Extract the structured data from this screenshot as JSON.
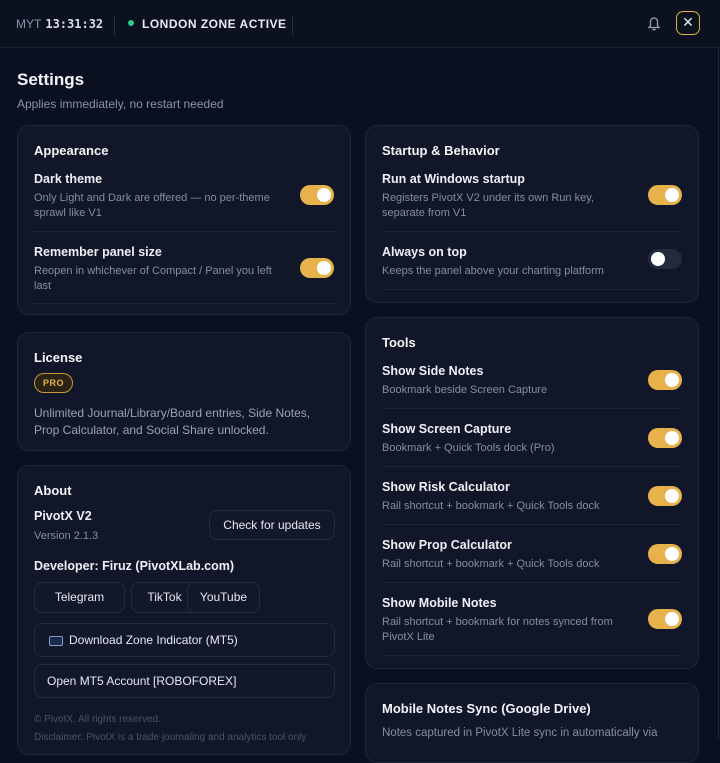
{
  "topbar": {
    "timezone": "MYT",
    "clock": "13:31:32",
    "zone_status": "LONDON ZONE ACTIVE"
  },
  "header": {
    "title": "Settings",
    "subtitle": "Applies immediately, no restart needed"
  },
  "appearance": {
    "title": "Appearance",
    "items": [
      {
        "title": "Dark theme",
        "desc": "Only Light and Dark are offered — no per-theme sprawl like V1",
        "on": true
      },
      {
        "title": "Remember panel size",
        "desc": "Reopen in whichever of Compact / Panel you left last",
        "on": true
      }
    ]
  },
  "license": {
    "title": "License",
    "badge": "PRO",
    "desc": "Unlimited Journal/Library/Board entries, Side Notes, Prop Calculator, and Social Share unlocked."
  },
  "about": {
    "title": "About",
    "product": "PivotX V2",
    "version": "Version 2.1.3",
    "check_updates": "Check for updates",
    "developer": "Developer: Firuz (PivotXLab.com)",
    "links": [
      "Telegram",
      "TikTok",
      "YouTube"
    ],
    "download": "Download Zone Indicator (MT5)",
    "open_account": "Open MT5 Account [ROBOFOREX]",
    "copyright": "© PivotX. All rights reserved.",
    "disclaimer": "Disclaimer: PivotX is a trade journaling and analytics tool only"
  },
  "startup": {
    "title": "Startup & Behavior",
    "items": [
      {
        "title": "Run at Windows startup",
        "desc": "Registers PivotX V2 under its own Run key, separate from V1",
        "on": true
      },
      {
        "title": "Always on top",
        "desc": "Keeps the panel above your charting platform",
        "on": false
      }
    ]
  },
  "tools": {
    "title": "Tools",
    "items": [
      {
        "title": "Show Side Notes",
        "desc": "Bookmark beside Screen Capture",
        "on": true
      },
      {
        "title": "Show Screen Capture",
        "desc": "Bookmark + Quick Tools dock (Pro)",
        "on": true
      },
      {
        "title": "Show Risk Calculator",
        "desc": "Rail shortcut + bookmark + Quick Tools dock",
        "on": true
      },
      {
        "title": "Show Prop Calculator",
        "desc": "Rail shortcut + bookmark + Quick Tools dock",
        "on": true
      },
      {
        "title": "Show Mobile Notes",
        "desc": "Rail shortcut + bookmark for notes synced from PivotX Lite",
        "on": true
      }
    ]
  },
  "mobile_sync": {
    "title": "Mobile Notes Sync (Google Drive)",
    "desc": "Notes captured in PivotX Lite sync in automatically via"
  }
}
